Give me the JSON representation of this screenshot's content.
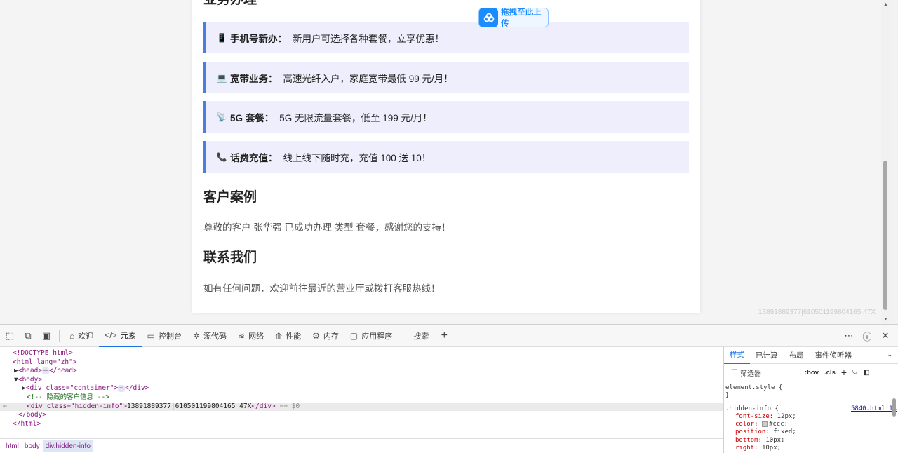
{
  "page": {
    "section_business_title": "业务办理",
    "upload_button": {
      "icon": "cloud-upload-icon",
      "label": "拖拽至此上传"
    },
    "services": [
      {
        "icon": "📱",
        "icon_name": "phone-icon",
        "name": "手机号新办：",
        "desc": "新用户可选择各种套餐，立享优惠！"
      },
      {
        "icon": "💻",
        "icon_name": "laptop-icon",
        "name": "宽带业务：",
        "desc": "高速光纤入户，家庭宽带最低 99 元/月！"
      },
      {
        "icon": "📡",
        "icon_name": "antenna-icon",
        "name": "5G 套餐：",
        "desc": "5G 无限流量套餐，低至 199 元/月！"
      },
      {
        "icon": "📞",
        "icon_name": "telephone-icon",
        "name": "话费充值：",
        "desc": "线上线下随时充，充值 100 送 10！"
      }
    ],
    "case_title": "客户案例",
    "case_text": "尊敬的客户 张华强 已成功办理 类型 套餐，感谢您的支持！",
    "contact_title": "联系我们",
    "contact_text": "如有任何问题，欢迎前往最近的营业厅或拨打客服热线！",
    "hidden_info": "13891889377|610501199804165 47X"
  },
  "devtools": {
    "tabs": [
      {
        "icon": "⌂",
        "label": "欢迎"
      },
      {
        "icon": "</>",
        "label": "元素"
      },
      {
        "icon": "▭",
        "label": "控制台"
      },
      {
        "icon": "✲",
        "label": "源代码"
      },
      {
        "icon": "≋",
        "label": "网络"
      },
      {
        "icon": "⟰",
        "label": "性能"
      },
      {
        "icon": "⚙",
        "label": "内存"
      },
      {
        "icon": "▢",
        "label": "应用程序"
      },
      {
        "icon": "",
        "label": "搜索"
      }
    ],
    "dom": {
      "doctype": "<!DOCTYPE html>",
      "html_open": "<html lang=\"zh\">",
      "head": "<head>",
      "head_close": "</head>",
      "body_open": "<body>",
      "container_open": "<div class=\"container\">",
      "div_close": "</div>",
      "comment": "<!-- 隐藏的客户信息 -->",
      "hidden_div_open": "<div class=\"hidden-info\">",
      "hidden_div_text": "13891889377|610501199804165 47X",
      "eq_marker": "== $0",
      "body_close": "</body>",
      "html_close": "</html>"
    },
    "breadcrumbs": [
      "html",
      "body",
      "div.hidden-info"
    ],
    "styles_tabs": [
      "样式",
      "已计算",
      "布局",
      "事件侦听器"
    ],
    "filter_placeholder": "筛选器",
    "hov": ":hov",
    "cls": ".cls",
    "element_style": "element.style {",
    "element_style_close": "}",
    "rule_selector": ".hidden-info {",
    "rule_source": "5840.html:14",
    "props": [
      {
        "name": "font-size",
        "value": "12px;"
      },
      {
        "name": "color",
        "value": "#ccc;",
        "swatch": "#cccccc"
      },
      {
        "name": "position",
        "value": "fixed;"
      },
      {
        "name": "bottom",
        "value": "10px;"
      },
      {
        "name": "right",
        "value": "10px;"
      }
    ]
  }
}
